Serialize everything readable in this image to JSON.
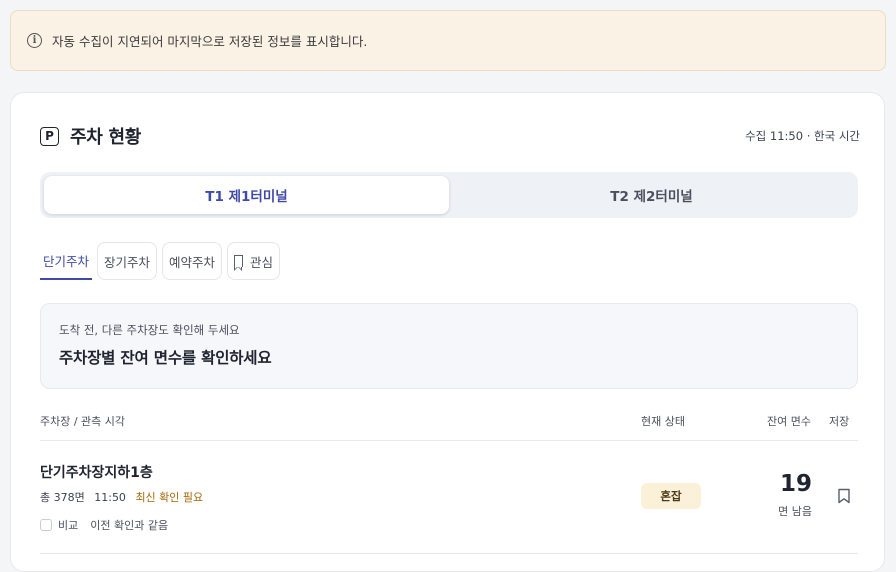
{
  "notice": {
    "icon": "info-icon",
    "text": "자동 수집이 지연되어 마지막으로 저장된 정보를 표시합니다."
  },
  "header": {
    "icon": "parking-icon",
    "icon_letter": "P",
    "title": "주차 현황",
    "meta": "수집 11:50 · 한국 시간"
  },
  "terminals": [
    {
      "label": "T1 제1터미널",
      "active": true
    },
    {
      "label": "T2 제2터미널",
      "active": false
    }
  ],
  "tabs": [
    {
      "label": "단기주차",
      "active": true
    },
    {
      "label": "장기주차",
      "active": false
    },
    {
      "label": "예약주차",
      "active": false
    },
    {
      "label": "관심",
      "active": false,
      "icon": "bookmark-icon"
    }
  ],
  "promo": {
    "sub": "도착 전, 다른 주차장도 확인해 두세요",
    "main": "주차장별 잔여 면수를 확인하세요"
  },
  "table": {
    "headers": {
      "lot": "주차장 / 관측 시각",
      "status": "현재 상태",
      "remaining": "잔여 면수",
      "save": "저장"
    },
    "rows": [
      {
        "name": "단기주차장지하1층",
        "total": "총 378면",
        "time": "11:50",
        "warning": "최신 확인 필요",
        "compare_label": "비교",
        "compare_note": "이전 확인과 같음",
        "status": "혼잡",
        "count": "19",
        "count_unit": "면 남음"
      }
    ]
  },
  "colors": {
    "accent": "#3f4aa8",
    "notice_bg": "#fbf2e6",
    "badge_bg": "#fbf1d9",
    "warning": "#a16a0b"
  }
}
